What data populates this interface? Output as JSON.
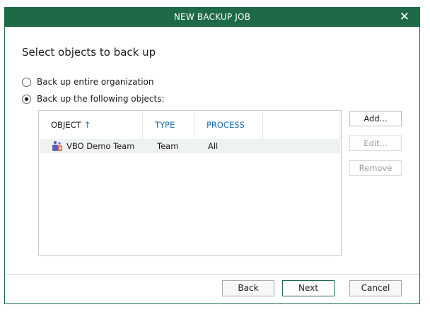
{
  "window": {
    "title": "NEW BACKUP JOB",
    "close_glyph": "✕"
  },
  "heading": "Select objects to back up",
  "options": [
    {
      "label": "Back up entire organization",
      "selected": false
    },
    {
      "label": "Back up the following objects:",
      "selected": true
    }
  ],
  "grid": {
    "columns": [
      "OBJECT",
      "TYPE",
      "PROCESS"
    ],
    "sort_glyph": "↑",
    "rows": [
      {
        "icon": "teams-icon",
        "object": "VBO Demo Team",
        "type": "Team",
        "process": "All"
      }
    ]
  },
  "side_buttons": {
    "add": "Add...",
    "edit": "Edit...",
    "remove": "Remove"
  },
  "footer": {
    "back": "Back",
    "next": "Next",
    "cancel": "Cancel"
  },
  "colors": {
    "titlebar": "#1e6a47",
    "column_link": "#1f6fb0",
    "selected_row": "#eef3ef"
  }
}
